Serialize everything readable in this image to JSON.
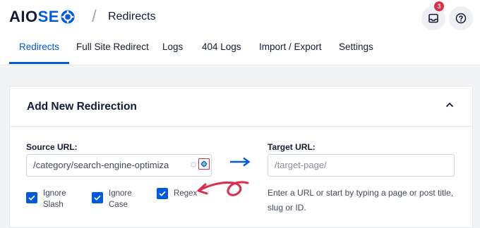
{
  "header": {
    "logo_part1": "AIO",
    "logo_part2": "SE",
    "separator": "/",
    "page_title": "Redirects",
    "notification_count": "3"
  },
  "tabs": [
    {
      "label": "Redirects",
      "active": true
    },
    {
      "label": "Full Site Redirect",
      "active": false
    },
    {
      "label": "Logs",
      "active": false
    },
    {
      "label": "404 Logs",
      "active": false
    },
    {
      "label": "Import / Export",
      "active": false
    },
    {
      "label": "Settings",
      "active": false
    }
  ],
  "card": {
    "title": "Add New Redirection",
    "source_label": "Source URL:",
    "source_value": "/category/search-engine-optimiza",
    "target_label": "Target URL:",
    "target_placeholder": "/target-page/",
    "help_text": "Enter a URL or start by typing a page or post title, slug or ID.",
    "options": [
      {
        "line1": "Ignore",
        "line2": "Slash",
        "checked": true
      },
      {
        "line1": "Ignore",
        "line2": "Case",
        "checked": true
      },
      {
        "line1": "Regex",
        "line2": "",
        "checked": true
      }
    ]
  },
  "colors": {
    "accent": "#005ae0",
    "badge": "#df2a4a",
    "annotation": "#df2a4a"
  },
  "icons": [
    "gear-logo-icon",
    "inbox-icon",
    "help-icon",
    "chevron-up-icon",
    "arrow-right-icon",
    "regex-gear-icon",
    "check-icon"
  ]
}
